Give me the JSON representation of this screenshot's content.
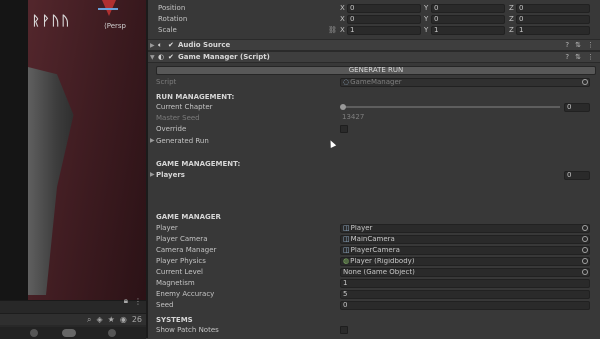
{
  "scene": {
    "rune_text": "ᚱᚹᚢᚢ",
    "persp_label": "⟨Persp"
  },
  "bottom_toolbar": {
    "icons": [
      "lock-icon",
      "menu-icon",
      "search-icon",
      "tag-icon",
      "eye-icon",
      "star-icon"
    ],
    "count": "26"
  },
  "transform": {
    "position": {
      "label": "Position",
      "x": "0",
      "y": "0",
      "z": "0"
    },
    "rotation": {
      "label": "Rotation",
      "x": "0",
      "y": "0",
      "z": "0"
    },
    "scale": {
      "label": "Scale",
      "x": "1",
      "y": "1",
      "z": "1"
    }
  },
  "components": {
    "audio_source": {
      "title": "Audio Source"
    },
    "game_manager": {
      "title": "Game Manager (Script)"
    }
  },
  "generate_button": "GENERATE RUN",
  "script_row": {
    "label": "Script",
    "value": "GameManager"
  },
  "run_management": {
    "header": "RUN MANAGEMENT:",
    "current_chapter": {
      "label": "Current Chapter",
      "value": "0"
    },
    "master_seed": {
      "label": "Master Seed",
      "value": "13427"
    },
    "override": {
      "label": "Override"
    },
    "generated_run": {
      "label": "Generated Run"
    }
  },
  "game_management": {
    "header": "GAME MANAGEMENT:",
    "players": {
      "label": "Players",
      "value": "0"
    }
  },
  "game_manager": {
    "header": "GAME MANAGER",
    "player": {
      "label": "Player",
      "value": "Player"
    },
    "player_camera": {
      "label": "Player Camera",
      "value": "MainCamera"
    },
    "camera_manager": {
      "label": "Camera Manager",
      "value": "PlayerCamera"
    },
    "player_physics": {
      "label": "Player Physics",
      "value": "Player (Rigidbody)"
    },
    "current_level": {
      "label": "Current Level",
      "value": "None (Game Object)"
    },
    "magnetism": {
      "label": "Magnetism",
      "value": "1"
    },
    "enemy_accuracy": {
      "label": "Enemy Accuracy",
      "value": "5"
    },
    "seed": {
      "label": "Seed",
      "value": "0"
    }
  },
  "systems": {
    "header": "SYSTEMS",
    "show_patch_notes": {
      "label": "Show Patch Notes"
    }
  },
  "colors": {
    "inspector_bg": "#383838",
    "field_bg": "#2a2a2a",
    "scene_wall": "#5a2a30"
  }
}
